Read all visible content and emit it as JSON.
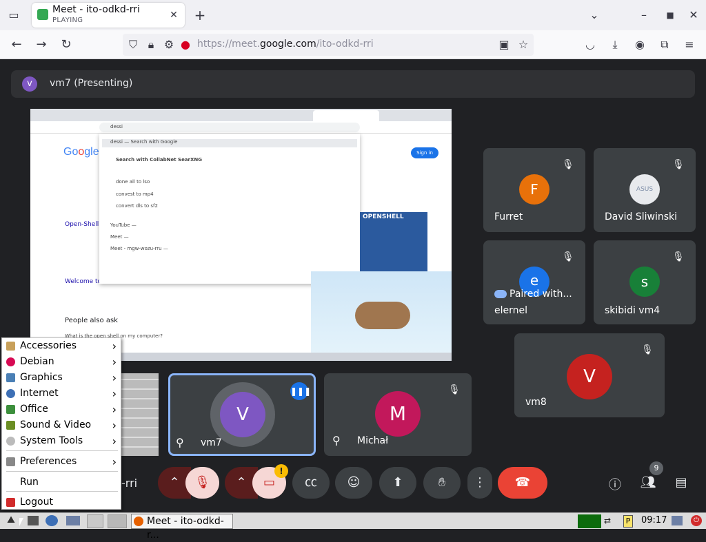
{
  "browser": {
    "tab": {
      "title": "Meet - ito-odkd-rri",
      "status": "PLAYING"
    },
    "url_prefix": "https://meet.",
    "url_domain": "google.com",
    "url_path": "/ito-odkd-rri"
  },
  "presenting": {
    "initial": "v",
    "label": "vm7 (Presenting)"
  },
  "shared_screen": {
    "search_query": "dessi",
    "suggest_first": "dessi — Search with Google",
    "collab_title": "Search with CollabNet SearXNG",
    "items": [
      "done all to lso",
      "convest to mp4",
      "convert dls to sf2"
    ],
    "history": [
      "YouTube — ",
      "Meet — ",
      "Meet - mgw-wozu-rru — "
    ],
    "sign_in": "Sign in",
    "result_1_title": "Open-Shell",
    "result_2_title": "Welcome to",
    "people_ask": "People also ask",
    "question": "What is the open shell on my computer?",
    "openshell": "OPENSHELL"
  },
  "participants": [
    {
      "name": "Furret",
      "initial": "F",
      "color": "#e8710a"
    },
    {
      "name": "David Sliwinski",
      "initial": "",
      "color": "#e8eaed"
    },
    {
      "name": "elernel",
      "initial": "e",
      "color": "#1a73e8",
      "badge": "Paired with..."
    },
    {
      "name": "skibidi vm4",
      "initial": "s",
      "color": "#188038"
    },
    {
      "name": "vm8",
      "initial": "V",
      "color": "#c5221f"
    },
    {
      "name": "vm7",
      "initial": "V",
      "color": "#7e57c2"
    },
    {
      "name": "Michał",
      "initial": "M",
      "color": "#c2185b"
    }
  ],
  "meeting_code": "-rri",
  "participants_count": "9",
  "menu": {
    "items": [
      "Accessories",
      "Debian",
      "Graphics",
      "Internet",
      "Office",
      "Sound & Video",
      "System Tools",
      "Preferences",
      "Run",
      "Logout"
    ]
  },
  "taskbar": {
    "window": "Meet - ito-odkd-r...",
    "clock": "09:17"
  }
}
